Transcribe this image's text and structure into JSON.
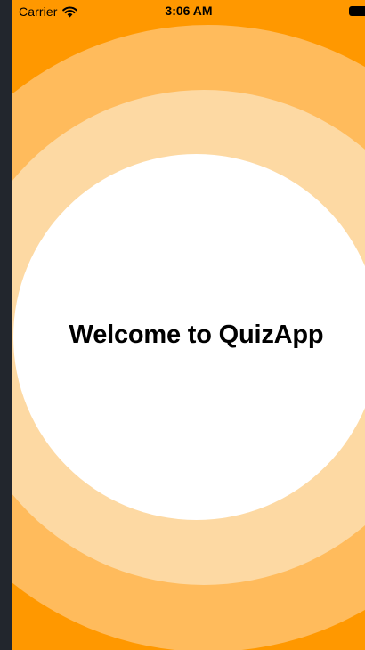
{
  "status_bar": {
    "carrier": "Carrier",
    "time": "3:06 AM",
    "wifi_icon": "wifi-icon",
    "battery_icon": "battery-icon"
  },
  "main": {
    "title": "Welcome to QuizApp"
  },
  "colors": {
    "background": "#ff9800",
    "ring_outer": "#ffbb5c",
    "ring_middle": "#fdd9a3",
    "ring_inner": "#ffffff",
    "text": "#000000"
  }
}
